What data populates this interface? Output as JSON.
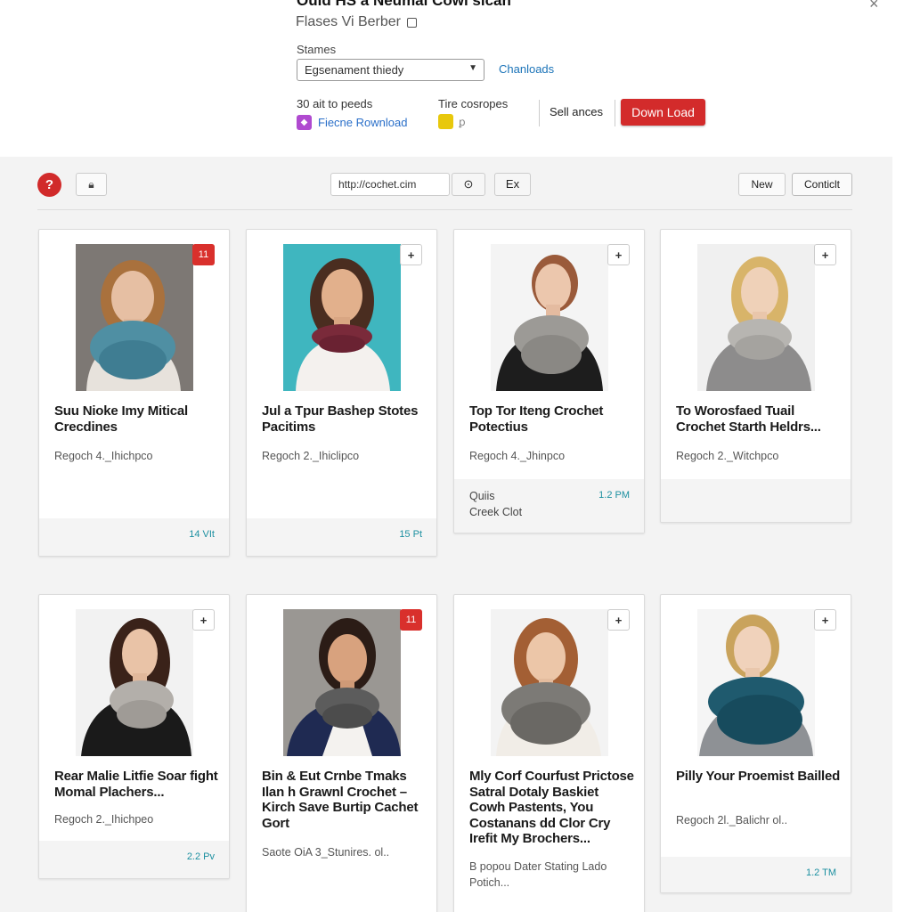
{
  "modal": {
    "title": "Ould HS a Neumal Cowl sican",
    "subtitle": "Flases Vi Berber",
    "close_glyph": "×",
    "stames_label": "Stames",
    "select_value": "Egsenament thiedy",
    "channels_link": "Chanloads",
    "perks_text": "30 ait to peeds",
    "feature_download": "Fiecne Rownload",
    "tire_label": "Tire cosropes",
    "tire_extra": "ꝑ",
    "sell_label": "Sell ances",
    "download_button": "Down Load"
  },
  "toolbar": {
    "logo_glyph": "?",
    "url_text": "http://cochet.cim",
    "go_glyph": "⊙",
    "ex_label": "Ex",
    "new_label": "New",
    "contact_label": "Conticlt"
  },
  "cards": [
    {
      "title": "Suu Nioke Imy Mitical Crecdines",
      "meta": "Regoch 4._Ihichpco",
      "time": "14 VIt",
      "badge": "11"
    },
    {
      "title": "Jul a Tpur Bashep Stotes Pacitims",
      "meta": "Regoch 2._Ihiclipco",
      "time": "15 Pt",
      "badge": "+"
    },
    {
      "title": "Top Tor Iteng Crochet Potectius",
      "meta": "Regoch 4._Jhinpco",
      "note1": "Quiis",
      "note2": "Creek Clot",
      "time": "1.2 PM",
      "badge": "+"
    },
    {
      "title": "To Worosfaed Tuail Crochet Starth Heldrs...",
      "meta": "Regoch 2._Witchpco",
      "badge": "+"
    },
    {
      "title": "Rear Malie Litfie Soar fight Momal Plachers...",
      "meta": "Regoch 2._Ihichpeo",
      "time": "2.2 Pv",
      "badge": "+"
    },
    {
      "title": "Bin & Eut Crnbe Tmaks Ilan h Grawnl Crochet – Kirch Save Burtip Cachet Gort",
      "meta": "Saote OiA 3_Stunires. ol..",
      "badge": "11"
    },
    {
      "title": "Mly Corf Courfust Prictose Satral Dotaly Baskiet Cowh Pastents, You Costanans dd Clor Cry Irefit My Brochers...",
      "meta": "B popou Dater Stating Lado Potich...",
      "badge": "+"
    },
    {
      "title": "Pilly Your Proemist Bailled",
      "meta": "Regoch 2l._Balichr ol..",
      "time": "1.2 TM",
      "badge": "+"
    }
  ],
  "colors": {
    "accent_red": "#d32b2b",
    "link_blue": "#1a73b8",
    "time_teal": "#1b8fa0"
  }
}
